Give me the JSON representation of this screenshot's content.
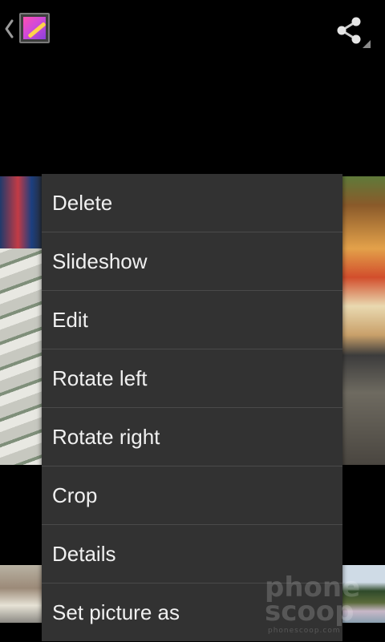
{
  "action_bar": {
    "up_icon": "chevron-left-icon",
    "app_icon": "gallery-app-icon",
    "share_icon": "share-icon",
    "overflow_indicator": "overflow-indicator-icon"
  },
  "menu": {
    "items": [
      {
        "label": "Delete"
      },
      {
        "label": "Slideshow"
      },
      {
        "label": "Edit"
      },
      {
        "label": "Rotate left"
      },
      {
        "label": "Rotate right"
      },
      {
        "label": "Crop"
      },
      {
        "label": "Details"
      },
      {
        "label": "Set picture as"
      }
    ]
  },
  "watermark": {
    "brand": "phone scoop",
    "url": "phonescoop.com"
  },
  "colors": {
    "background": "#000000",
    "menu_background": "#323232",
    "menu_divider": "#4a4a4a",
    "menu_text": "#f0f0f0"
  }
}
